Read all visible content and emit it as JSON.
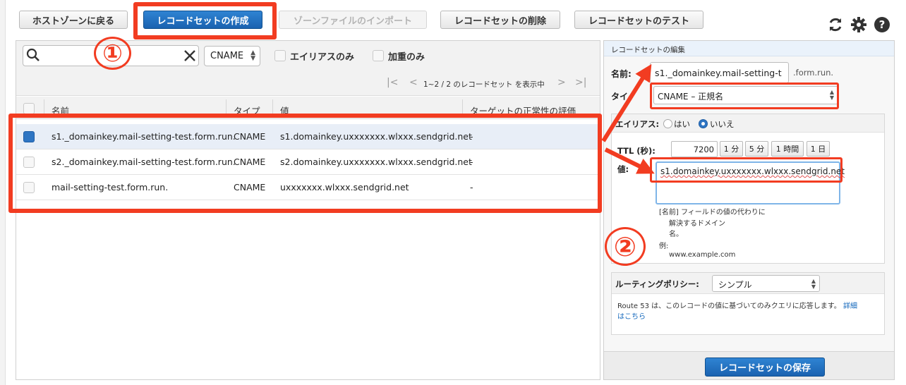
{
  "toolbar": {
    "back_label": "ホストゾーンに戻る",
    "create_label": "レコードセットの作成",
    "import_label": "ゾーンファイルのインポート",
    "delete_label": "レコードセットの削除",
    "test_label": "レコードセットのテスト"
  },
  "filter": {
    "search_value": "",
    "type_select": "CNAME",
    "alias_only": "エイリアスのみ",
    "weighted_only": "加重のみ"
  },
  "pagination": {
    "text": "1~2 / 2 のレコードセット を表示中"
  },
  "table": {
    "headers": [
      "名前",
      "タイプ",
      "値",
      "ターゲットの正常性の評価"
    ],
    "rows": [
      {
        "name": "s1._domainkey.mail-setting-test.form.run.",
        "type": "CNAME",
        "value": "s1.domainkey.uxxxxxxx.wlxxx.sendgrid.net",
        "health": "-",
        "selected": true
      },
      {
        "name": "s2._domainkey.mail-setting-test.form.run.",
        "type": "CNAME",
        "value": "s2.domainkey.uxxxxxxx.wlxxx.sendgrid.net",
        "health": "-",
        "selected": false
      },
      {
        "name": "mail-setting-test.form.run.",
        "type": "CNAME",
        "value": "uxxxxxxx.wlxxx.sendgrid.net",
        "health": "-",
        "selected": false
      }
    ]
  },
  "annotations": {
    "one": "①",
    "two": "②"
  },
  "panel": {
    "title": "レコードセットの編集",
    "name_label": "名前:",
    "name_value": "s1._domainkey.mail-setting-t",
    "name_suffix": ".form.run.",
    "type_label": "タイ",
    "type_value": "CNAME – 正規名",
    "alias_label": "エイリアス:",
    "alias_yes": "はい",
    "alias_no": "いいえ",
    "ttl_label": "TTL (秒):",
    "ttl_value": "7200",
    "ttl_buttons": [
      "1 分",
      "5 分",
      "1 時間",
      "1 日"
    ],
    "value_label": "値:",
    "value_text": "s1.domainkey.uxxxxxxx.wlxxx.sendgrid.net",
    "help_line1": "[名前] フィールドの値の代わりに",
    "help_line2": "解決するドメイン",
    "help_line3": "名。",
    "help_example_label": "例:",
    "help_example": "www.example.com",
    "routing_label": "ルーティングポリシー:",
    "routing_value": "シンプル",
    "routing_desc": "Route 53 は、このレコードの値に基づいてのみクエリに応答します。",
    "routing_link1": "詳細",
    "routing_link2": "はこちら",
    "save_label": "レコードセットの保存"
  },
  "colors": {
    "annotation_red": "#f23c21",
    "primary_blue": "#1a62b0",
    "link": "#1166bb"
  }
}
